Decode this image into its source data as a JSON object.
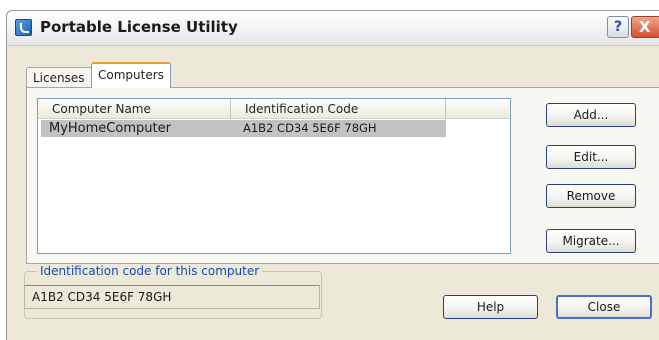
{
  "window": {
    "title": "Portable License Utility",
    "help_glyph": "?",
    "close_glyph": "X"
  },
  "tabs": [
    {
      "label": "Licenses",
      "active": false
    },
    {
      "label": "Computers",
      "active": true
    }
  ],
  "computers_list": {
    "columns": [
      "Computer Name",
      "Identification Code"
    ],
    "rows": [
      {
        "name": "MyHomeComputer",
        "code": "A1B2 CD34 5E6F 78GH",
        "selected": true
      }
    ]
  },
  "side_buttons": {
    "add": "Add...",
    "edit": "Edit...",
    "remove": "Remove",
    "migrate": "Migrate..."
  },
  "id_group": {
    "legend": "Identification code for this computer",
    "value": "A1B2 CD34 5E6F 78GH"
  },
  "footer_buttons": {
    "help": "Help",
    "close": "Close"
  },
  "colors": {
    "dialog_bg": "#ece9d8",
    "selected_row": "#c2c2c2",
    "legend_text": "#1f47b0",
    "close_button": "#d4512f"
  },
  "icons": {
    "app": "portable-license-app-icon",
    "help": "help-icon",
    "close": "close-icon"
  }
}
